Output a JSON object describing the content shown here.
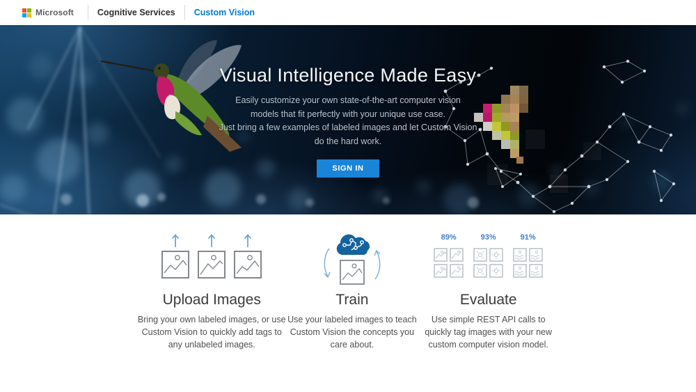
{
  "nav": {
    "microsoft_label": "Microsoft",
    "cognitive_services_label": "Cognitive Services",
    "custom_vision_label": "Custom Vision"
  },
  "hero": {
    "title": "Visual Intelligence Made Easy",
    "subtitle_lines": [
      "Easily customize your own state-of-the-art computer vision",
      "models that fit perfectly with your unique use case.",
      "Just bring a few examples of labeled images and let Custom Vision",
      "do the hard work."
    ],
    "sign_in_label": "SIGN IN"
  },
  "features": {
    "upload": {
      "title": "Upload Images",
      "description": "Bring your own labeled images, or use Custom Vision to quickly add tags to any unlabeled images."
    },
    "train": {
      "title": "Train",
      "description": "Use your labeled images to teach Custom Vision the concepts you care about."
    },
    "evaluate": {
      "title": "Evaluate",
      "description": "Use simple REST API calls to quickly tag images with your new custom computer vision model.",
      "scores": [
        "89%",
        "93%",
        "91%"
      ]
    }
  },
  "icons": {
    "microsoft_logo": "four-color-squares",
    "upload_arrow": "arrow-up",
    "upload_image": "photo-frame",
    "train_brain": "brain-cloud",
    "train_cycle": "circular-arrows",
    "evaluate_tiles": "photo-grid"
  },
  "colors": {
    "accent_blue": "#1a84d8",
    "link_blue": "#0078d4",
    "score_blue": "#3f7fd2",
    "brain_blue": "#15639e",
    "hero_bg_dark": "#051120",
    "icon_gray": "#82878c",
    "eval_icon_gray": "#b9bfc6"
  }
}
